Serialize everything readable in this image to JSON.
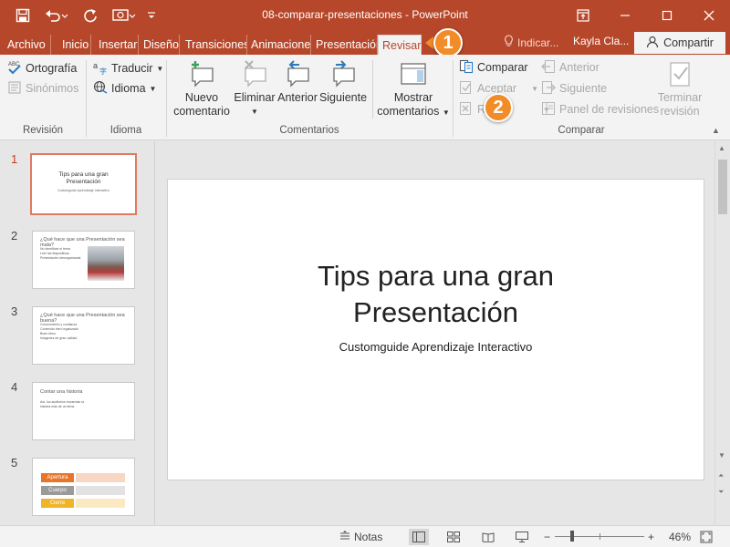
{
  "window": {
    "title": "08-comparar-presentaciones - PowerPoint"
  },
  "tabs": [
    {
      "label": "Archivo"
    },
    {
      "label": "Inicio"
    },
    {
      "label": "Insertar"
    },
    {
      "label": "Diseño"
    },
    {
      "label": "Transiciones"
    },
    {
      "label": "Animaciones"
    },
    {
      "label": "Presentación"
    },
    {
      "label": "Revisar"
    }
  ],
  "header": {
    "tell_me": "Indicar...",
    "user": "Kayla Cla...",
    "share": "Compartir"
  },
  "callouts": {
    "one": "1",
    "two": "2"
  },
  "ribbon": {
    "revision": {
      "label": "Revisión",
      "spelling": "Ortografía",
      "thesaurus": "Sinónimos"
    },
    "language": {
      "label": "Idioma",
      "translate": "Traducir",
      "language": "Idioma"
    },
    "comments": {
      "label": "Comentarios",
      "new_line1": "Nuevo",
      "new_line2": "comentario",
      "delete": "Eliminar",
      "previous": "Anterior",
      "next": "Siguiente",
      "show_line1": "Mostrar",
      "show_line2": "comentarios"
    },
    "compare": {
      "label": "Comparar",
      "compare": "Comparar",
      "accept": "Aceptar",
      "reject": "Rechazar",
      "previous": "Anterior",
      "next": "Siguiente",
      "reviewing_pane": "Panel de revisiones",
      "end_line1": "Terminar",
      "end_line2": "revisión"
    }
  },
  "slides": [
    {
      "number": "1",
      "title": "Tips para una gran Presentación",
      "subtitle": "Customguide Aprendizaje Interactivo"
    },
    {
      "number": "2",
      "title": "¿Qué hace que una Presentación sea mala?",
      "bullets": [
        "No identificar el tema",
        "Leer las diapositivas",
        "Presentación desorganizada"
      ]
    },
    {
      "number": "3",
      "title": "¿Qué hace que una Presentación sea buena?",
      "bullets": [
        "Conocimiento y confianza",
        "Contenido bien organizado",
        "Buen ritmo",
        "Imágenes de gran calidad"
      ]
    },
    {
      "number": "4",
      "title": "Contar una historia",
      "bullets": [
        "Así, los auditorios recuerdan la",
        "historia más de un tema"
      ]
    },
    {
      "number": "5",
      "boxes": [
        "Apertura",
        "Cuerpo",
        "Cierre"
      ]
    }
  ],
  "main_slide": {
    "title_line1": "Tips para una gran",
    "title_line2": "Presentación",
    "subtitle": "Customguide Aprendizaje Interactivo"
  },
  "statusbar": {
    "notes": "Notas",
    "zoom": "46%",
    "zoom_level": 0.46
  },
  "colors": {
    "accent": "#b7472a",
    "callout": "#f28c28",
    "active_slide_border": "#e07a5f"
  }
}
